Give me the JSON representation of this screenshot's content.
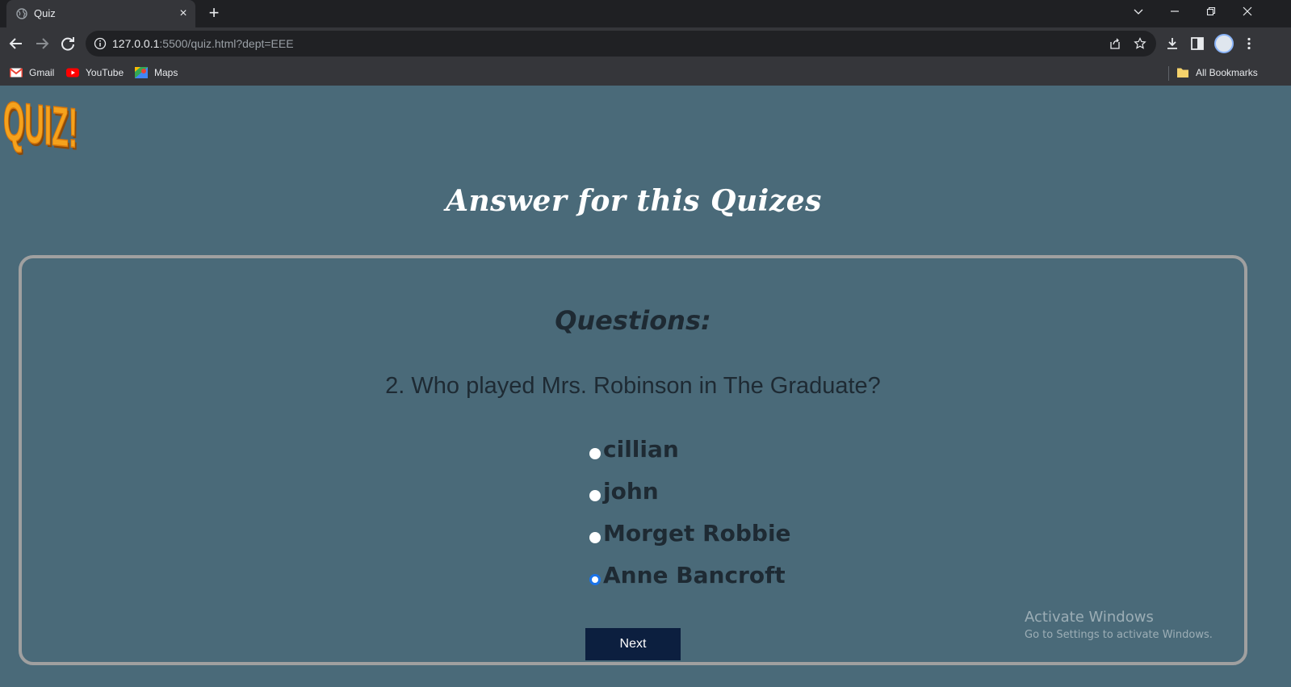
{
  "browser": {
    "tab": {
      "title": "Quiz",
      "close_glyph": "×",
      "favicon": "globe-icon"
    },
    "new_tab_glyph": "+",
    "url": {
      "host": "127.0.0.1",
      "rest": ":5500/quiz.html?dept=EEE"
    },
    "bookmarks": [
      {
        "label": "Gmail",
        "icon": "gmail-icon"
      },
      {
        "label": "YouTube",
        "icon": "youtube-icon"
      },
      {
        "label": "Maps",
        "icon": "maps-icon"
      }
    ],
    "all_bookmarks_label": "All Bookmarks"
  },
  "page": {
    "logo_text": "QUIZ!",
    "title": "Answer for this Quizes",
    "questions_heading": "Questions:",
    "question": "2. Who played Mrs. Robinson in The Graduate?",
    "options": [
      {
        "label": "cillian",
        "selected": false
      },
      {
        "label": "john",
        "selected": false
      },
      {
        "label": "Morget Robbie",
        "selected": false
      },
      {
        "label": "Anne Bancroft",
        "selected": true
      }
    ],
    "next_label": "Next"
  },
  "watermark": {
    "title": "Activate Windows",
    "subtitle": "Go to Settings to activate Windows."
  },
  "colors": {
    "page_bg": "#4a6a79",
    "button_bg": "#0c1f3f",
    "logo_orange": "#f5a21c"
  }
}
